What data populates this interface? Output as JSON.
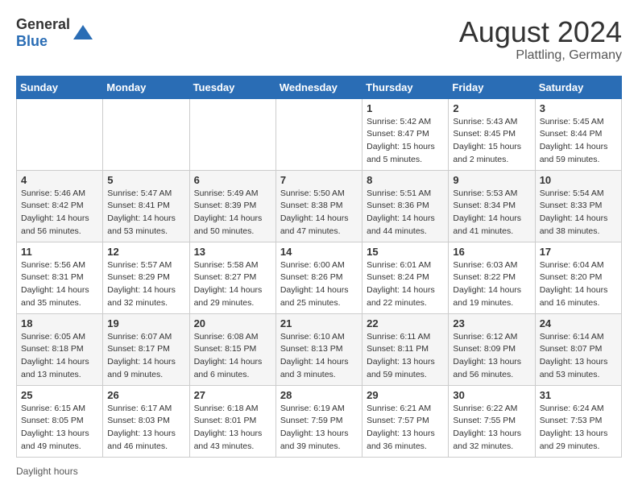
{
  "header": {
    "logo": {
      "general": "General",
      "blue": "Blue"
    },
    "title": "August 2024",
    "location": "Plattling, Germany"
  },
  "calendar": {
    "days_of_week": [
      "Sunday",
      "Monday",
      "Tuesday",
      "Wednesday",
      "Thursday",
      "Friday",
      "Saturday"
    ],
    "weeks": [
      [
        {
          "day": "",
          "info": ""
        },
        {
          "day": "",
          "info": ""
        },
        {
          "day": "",
          "info": ""
        },
        {
          "day": "",
          "info": ""
        },
        {
          "day": "1",
          "info": "Sunrise: 5:42 AM\nSunset: 8:47 PM\nDaylight: 15 hours and 5 minutes."
        },
        {
          "day": "2",
          "info": "Sunrise: 5:43 AM\nSunset: 8:45 PM\nDaylight: 15 hours and 2 minutes."
        },
        {
          "day": "3",
          "info": "Sunrise: 5:45 AM\nSunset: 8:44 PM\nDaylight: 14 hours and 59 minutes."
        }
      ],
      [
        {
          "day": "4",
          "info": "Sunrise: 5:46 AM\nSunset: 8:42 PM\nDaylight: 14 hours and 56 minutes."
        },
        {
          "day": "5",
          "info": "Sunrise: 5:47 AM\nSunset: 8:41 PM\nDaylight: 14 hours and 53 minutes."
        },
        {
          "day": "6",
          "info": "Sunrise: 5:49 AM\nSunset: 8:39 PM\nDaylight: 14 hours and 50 minutes."
        },
        {
          "day": "7",
          "info": "Sunrise: 5:50 AM\nSunset: 8:38 PM\nDaylight: 14 hours and 47 minutes."
        },
        {
          "day": "8",
          "info": "Sunrise: 5:51 AM\nSunset: 8:36 PM\nDaylight: 14 hours and 44 minutes."
        },
        {
          "day": "9",
          "info": "Sunrise: 5:53 AM\nSunset: 8:34 PM\nDaylight: 14 hours and 41 minutes."
        },
        {
          "day": "10",
          "info": "Sunrise: 5:54 AM\nSunset: 8:33 PM\nDaylight: 14 hours and 38 minutes."
        }
      ],
      [
        {
          "day": "11",
          "info": "Sunrise: 5:56 AM\nSunset: 8:31 PM\nDaylight: 14 hours and 35 minutes."
        },
        {
          "day": "12",
          "info": "Sunrise: 5:57 AM\nSunset: 8:29 PM\nDaylight: 14 hours and 32 minutes."
        },
        {
          "day": "13",
          "info": "Sunrise: 5:58 AM\nSunset: 8:27 PM\nDaylight: 14 hours and 29 minutes."
        },
        {
          "day": "14",
          "info": "Sunrise: 6:00 AM\nSunset: 8:26 PM\nDaylight: 14 hours and 25 minutes."
        },
        {
          "day": "15",
          "info": "Sunrise: 6:01 AM\nSunset: 8:24 PM\nDaylight: 14 hours and 22 minutes."
        },
        {
          "day": "16",
          "info": "Sunrise: 6:03 AM\nSunset: 8:22 PM\nDaylight: 14 hours and 19 minutes."
        },
        {
          "day": "17",
          "info": "Sunrise: 6:04 AM\nSunset: 8:20 PM\nDaylight: 14 hours and 16 minutes."
        }
      ],
      [
        {
          "day": "18",
          "info": "Sunrise: 6:05 AM\nSunset: 8:18 PM\nDaylight: 14 hours and 13 minutes."
        },
        {
          "day": "19",
          "info": "Sunrise: 6:07 AM\nSunset: 8:17 PM\nDaylight: 14 hours and 9 minutes."
        },
        {
          "day": "20",
          "info": "Sunrise: 6:08 AM\nSunset: 8:15 PM\nDaylight: 14 hours and 6 minutes."
        },
        {
          "day": "21",
          "info": "Sunrise: 6:10 AM\nSunset: 8:13 PM\nDaylight: 14 hours and 3 minutes."
        },
        {
          "day": "22",
          "info": "Sunrise: 6:11 AM\nSunset: 8:11 PM\nDaylight: 13 hours and 59 minutes."
        },
        {
          "day": "23",
          "info": "Sunrise: 6:12 AM\nSunset: 8:09 PM\nDaylight: 13 hours and 56 minutes."
        },
        {
          "day": "24",
          "info": "Sunrise: 6:14 AM\nSunset: 8:07 PM\nDaylight: 13 hours and 53 minutes."
        }
      ],
      [
        {
          "day": "25",
          "info": "Sunrise: 6:15 AM\nSunset: 8:05 PM\nDaylight: 13 hours and 49 minutes."
        },
        {
          "day": "26",
          "info": "Sunrise: 6:17 AM\nSunset: 8:03 PM\nDaylight: 13 hours and 46 minutes."
        },
        {
          "day": "27",
          "info": "Sunrise: 6:18 AM\nSunset: 8:01 PM\nDaylight: 13 hours and 43 minutes."
        },
        {
          "day": "28",
          "info": "Sunrise: 6:19 AM\nSunset: 7:59 PM\nDaylight: 13 hours and 39 minutes."
        },
        {
          "day": "29",
          "info": "Sunrise: 6:21 AM\nSunset: 7:57 PM\nDaylight: 13 hours and 36 minutes."
        },
        {
          "day": "30",
          "info": "Sunrise: 6:22 AM\nSunset: 7:55 PM\nDaylight: 13 hours and 32 minutes."
        },
        {
          "day": "31",
          "info": "Sunrise: 6:24 AM\nSunset: 7:53 PM\nDaylight: 13 hours and 29 minutes."
        }
      ]
    ]
  },
  "footer": {
    "note": "Daylight hours"
  }
}
